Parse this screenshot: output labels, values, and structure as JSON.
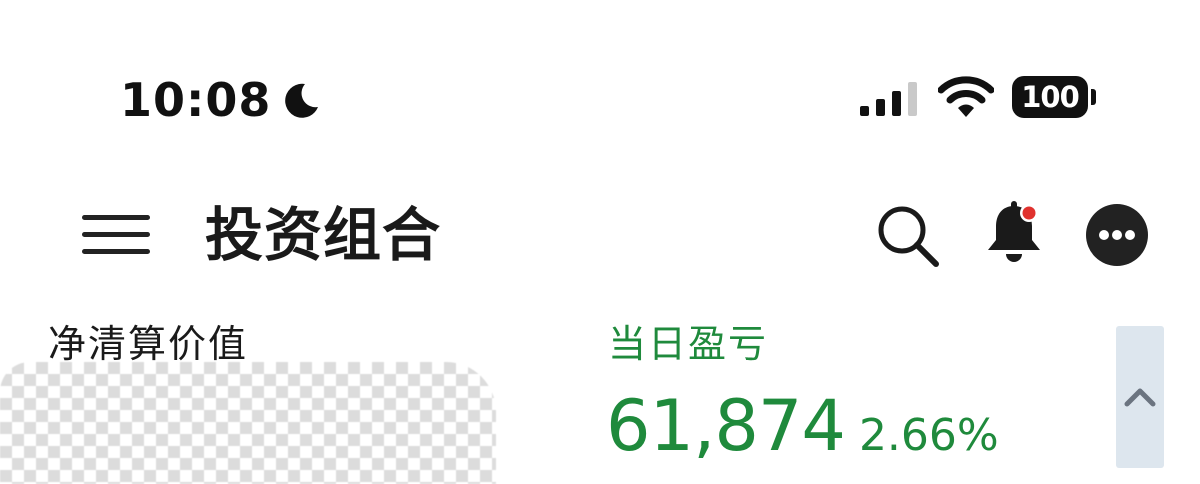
{
  "status_bar": {
    "time": "10:08",
    "battery": "100",
    "icons": [
      "moon-icon",
      "cellular-signal-icon",
      "wifi-icon",
      "battery-icon"
    ]
  },
  "header": {
    "title": "投资组合",
    "icons": [
      "hamburger-menu-icon",
      "search-icon",
      "bell-icon",
      "more-icon"
    ],
    "notification_dot_color": "#e0322e"
  },
  "summary": {
    "net_liquidation_label": "净清算价值",
    "daily_pnl_label": "当日盈亏",
    "daily_pnl_value": "61,874",
    "daily_pnl_percent": "2.66%",
    "positive_color": "#1f8a3c",
    "collapse_icon": "chevron-up-icon"
  }
}
